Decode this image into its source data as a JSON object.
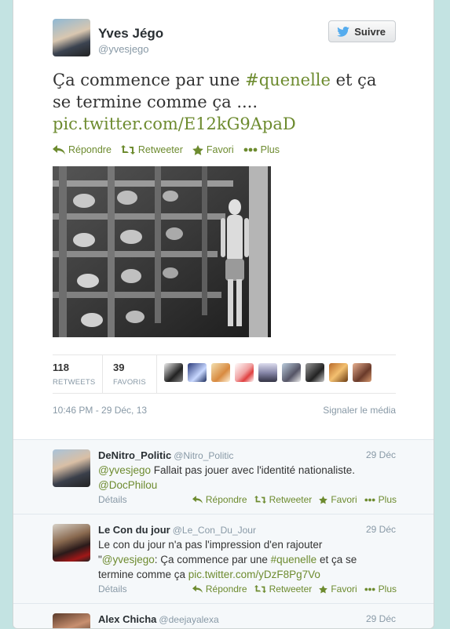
{
  "tweet": {
    "author_name": "Yves Jégo",
    "author_handle": "@yvesjego",
    "follow_label": "Suivre",
    "text_prefix": "Ça commence par une ",
    "hashtag": "#quenelle",
    "text_suffix": " et ça se termine comme ça ....",
    "pic_link": "pic.twitter.com/E12kG9ApaD",
    "actions": {
      "reply": "Répondre",
      "retweet": "Retweeter",
      "favorite": "Favori",
      "more": "Plus"
    },
    "retweets_count": "118",
    "retweets_label": "RETWEETS",
    "favorites_count": "39",
    "favorites_label": "FAVORIS",
    "timestamp": "10:46 PM - 29 Déc, 13",
    "report_media": "Signaler le média"
  },
  "replies": [
    {
      "name": "DeNitro_Politic",
      "handle": "@Nitro_Politic",
      "date": "29 Déc",
      "mention": "@yvesjego",
      "text": " Fallait pas jouer avec l'identité nationaliste.",
      "mention2": "@DocPhilou",
      "details": "Détails"
    },
    {
      "name": "Le Con du jour",
      "handle": "@Le_Con_Du_Jour",
      "date": "29 Déc",
      "text_line1": "Le con du jour n'a pas l'impression d'en rajouter",
      "quote_open": "\"",
      "mention": "@yvesjego",
      "text_mid": ": Ça commence par une ",
      "hashtag": "#quenelle",
      "text_end": " et ça se",
      "text_line3": "termine comme ça ",
      "link": "pic.twitter.com/yDzF8Pg7Vo",
      "details": "Détails"
    },
    {
      "name": "Alex Chicha",
      "handle": "@deejayalexa",
      "date": "29 Déc"
    }
  ],
  "reply_actions": {
    "reply": "Répondre",
    "retweet": "Retweeter",
    "favorite": "Favori",
    "more": "Plus"
  },
  "colors": {
    "link": "#6d8b2f",
    "muted": "#8899a6",
    "background": "#c3e3e2"
  }
}
